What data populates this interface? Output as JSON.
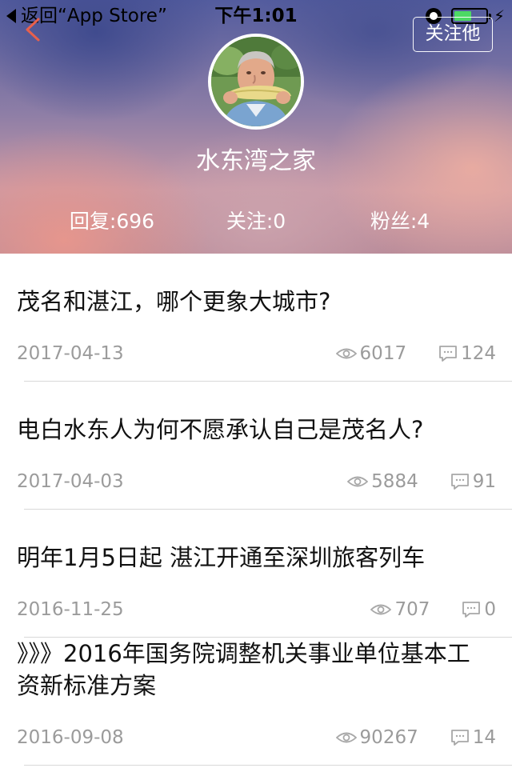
{
  "status_bar": {
    "back_app_label": "返回“App Store”",
    "time": "下午1:01",
    "battery_level": 0.55,
    "icons": [
      "back-triangle-icon",
      "alarm-icon",
      "battery-icon",
      "charging-bolt-icon"
    ]
  },
  "nav": {
    "back_icon": "chevron-left-icon",
    "follow_label": "关注他",
    "accent_color": "#e8604c"
  },
  "profile": {
    "username": "水东湾之家",
    "stats": {
      "replies": "回复:696",
      "following": "关注:0",
      "fans": "粉丝:4"
    }
  },
  "posts": [
    {
      "title": "茂名和湛江，哪个更象大城市?",
      "date": "2017-04-13",
      "views": "6017",
      "comments": "124"
    },
    {
      "title": "电白水东人为何不愿承认自己是茂名人?",
      "date": "2017-04-03",
      "views": "5884",
      "comments": "91"
    },
    {
      "title": "明年1月5日起 湛江开通至深圳旅客列车",
      "date": "2016-11-25",
      "views": "707",
      "comments": "0"
    },
    {
      "title": "》》》2016年国务院调整机关事业单位基本工资新标准方案",
      "date": "2016-09-08",
      "views": "90267",
      "comments": "14"
    }
  ]
}
